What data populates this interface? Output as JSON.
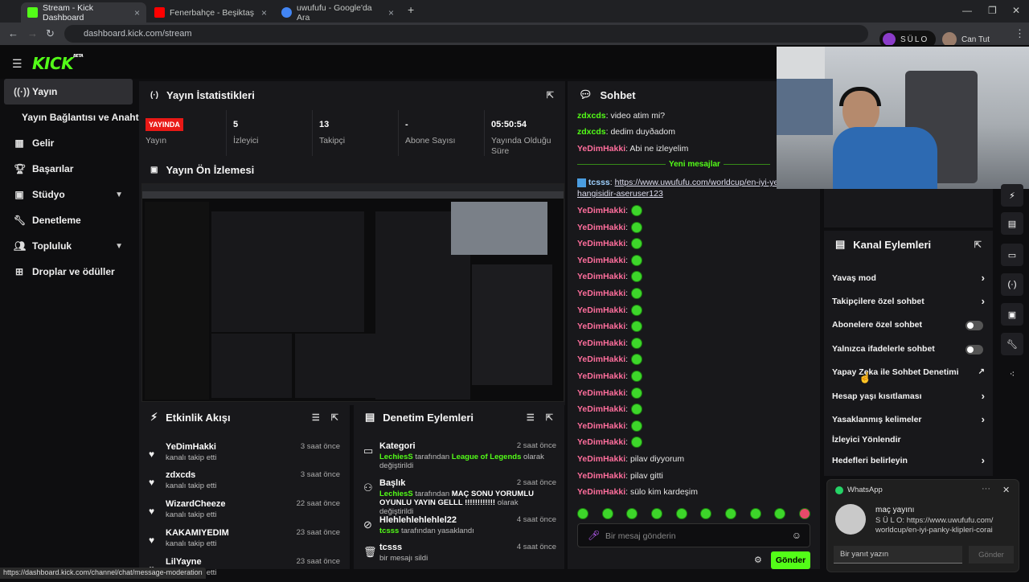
{
  "browser": {
    "tabs": [
      {
        "title": "Stream - Kick Dashboard",
        "color": "#53fc18"
      },
      {
        "title": "Fenerbahçe - Beşiktaş Maç Son",
        "color": "#ff0000"
      },
      {
        "title": "uwufufu - Google'da Ara",
        "color": "#4285f4"
      }
    ],
    "url": "dashboard.kick.com/stream",
    "profile_chip": "SÜLO",
    "profile_name": "Can Tut"
  },
  "app": {
    "logo": "KICK",
    "logo_badge": "BETA",
    "sidebar": [
      {
        "label": "Yayın",
        "icon": "broadcast-icon",
        "active": true
      },
      {
        "label": "Yayın Bağlantısı ve Anahtarı",
        "icon": "",
        "active": false
      },
      {
        "label": "Gelir",
        "icon": "revenue-icon",
        "active": false
      },
      {
        "label": "Başarılar",
        "icon": "trophy-icon",
        "active": false
      },
      {
        "label": "Stüdyo",
        "icon": "studio-icon",
        "active": false,
        "chevron": true
      },
      {
        "label": "Denetleme",
        "icon": "wrench-icon",
        "active": false
      },
      {
        "label": "Topluluk",
        "icon": "community-icon",
        "active": false,
        "chevron": true
      },
      {
        "label": "Droplar ve ödüller",
        "icon": "drops-icon",
        "active": false
      }
    ]
  },
  "stats": {
    "title": "Yayın İstatistikleri",
    "live_badge": "YAYINDA",
    "items": [
      {
        "value": "",
        "label": "Yayın"
      },
      {
        "value": "5",
        "label": "İzleyici"
      },
      {
        "value": "13",
        "label": "Takipçi"
      },
      {
        "value": "-",
        "label": "Abone Sayısı"
      },
      {
        "value": "05:50:54",
        "label": "Yayında Olduğu Süre"
      }
    ]
  },
  "preview": {
    "title": "Yayın Ön İzlemesi"
  },
  "activity": {
    "title": "Etkinlik Akışı",
    "rows": [
      {
        "name": "YeDimHakki",
        "desc": "kanalı takip etti",
        "time": "3 saat önce"
      },
      {
        "name": "zdxcds",
        "desc": "kanalı takip etti",
        "time": "3 saat önce"
      },
      {
        "name": "WizardCheeze",
        "desc": "kanalı takip etti",
        "time": "22 saat önce"
      },
      {
        "name": "KAKAMIYEDIM",
        "desc": "kanalı takip etti",
        "time": "23 saat önce"
      },
      {
        "name": "LilYayne",
        "desc": "kanalı takip etti",
        "time": "23 saat önce"
      }
    ]
  },
  "moderation": {
    "title": "Denetim Eylemleri",
    "rows": [
      {
        "name": "Kategori",
        "actor": "LechiesS",
        "mid": " tarafından ",
        "target": "League of Legends",
        "end": " olarak değiştirildi",
        "time": "2 saat önce",
        "icon": "category-icon"
      },
      {
        "name": "Başlık",
        "actor": "LechiesS",
        "mid": " tarafından ",
        "target": "MAÇ SONU YORUMLU OYUNLU YAYIN GELLL !!!!!!!!!!!!",
        "end": " olarak değiştirildi",
        "time": "2 saat önce",
        "icon": "title-icon"
      },
      {
        "name": "Hlehlehlehlehlel22",
        "actor": "tcsss",
        "mid": " tarafından yasaklandı",
        "target": "",
        "end": "",
        "time": "4 saat önce",
        "icon": "ban-icon"
      },
      {
        "name": "tcsss",
        "actor": "",
        "mid": "bir mesajı sildi",
        "target": "",
        "end": "",
        "time": "4 saat önce",
        "icon": "trash-icon"
      }
    ]
  },
  "chat": {
    "title": "Sohbet",
    "new_messages": "Yeni mesajlar",
    "lines_before": [
      {
        "user": "zdxcds",
        "text": "video atim mi?",
        "color": "green"
      },
      {
        "user": "zdxcds",
        "text": "dedim duyðadom",
        "color": "green"
      },
      {
        "user": "YeDimHakki",
        "text": "Abi ne izleyelim",
        "color": "pink"
      }
    ],
    "link_user": "tcsss",
    "link_text": "https://www.uwufufu.com/worldcup/en-iyi-yemek-",
    "link_text2": "hangisidir-aseruser123",
    "emote_user": "YeDimHakki",
    "emote_count": 15,
    "lines_after": [
      {
        "user": "YeDimHakki",
        "text": "pilav diyyorum"
      },
      {
        "user": "YeDimHakki",
        "text": "pilav gitti"
      },
      {
        "user": "YeDimHakki",
        "text": "sülo kim kardeşim"
      }
    ],
    "input_placeholder": "Bir mesaj gönderin",
    "send": "Gönder"
  },
  "channel_actions": {
    "title": "Kanal Eylemleri",
    "rows": [
      {
        "label": "Yavaş mod",
        "kind": "chevron"
      },
      {
        "label": "Takipçilere özel sohbet",
        "kind": "chevron"
      },
      {
        "label": "Abonelere özel sohbet",
        "kind": "toggle"
      },
      {
        "label": "Yalnızca ifadelerle sohbet",
        "kind": "toggle"
      },
      {
        "label": "Yapay Zeka ile Sohbet Denetimi",
        "kind": "external"
      },
      {
        "label": "Hesap yaşı kısıtlaması",
        "kind": "chevron"
      },
      {
        "label": "Yasaklanmış kelimeler",
        "kind": "chevron"
      },
      {
        "label": "İzleyici Yönlendir",
        "kind": "none"
      },
      {
        "label": "Hedefleri belirleyin",
        "kind": "chevron"
      }
    ]
  },
  "whatsapp": {
    "app": "WhatsApp",
    "title": "maç yayını",
    "body": "S Ü L O: https://www.uwufufu.com/ worldcup/en-iyi-panky-klipleri-corai",
    "reply_placeholder": "Bir yanıt yazın",
    "send": "Gönder"
  },
  "status_url": "https://dashboard.kick.com/channel/chat/message-moderation"
}
